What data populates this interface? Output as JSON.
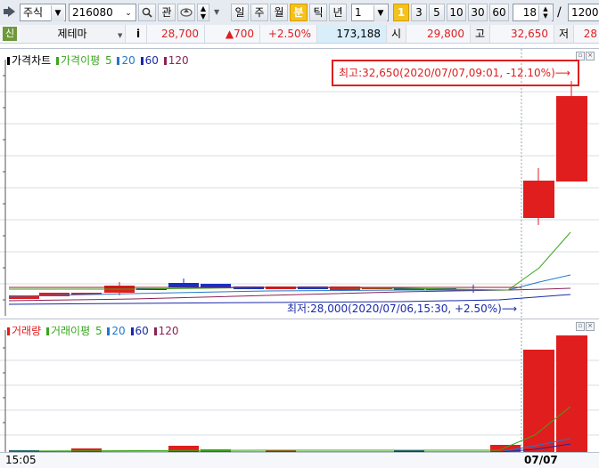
{
  "toolbar": {
    "market_type": "주식",
    "stock_code": "216080",
    "interest_label": "관",
    "periods": [
      "일",
      "주",
      "월",
      "분",
      "틱",
      "년"
    ],
    "selected_period": "분",
    "interval_value": "1",
    "minute_options": [
      "1",
      "3",
      "5",
      "10",
      "30",
      "60"
    ],
    "selected_minute": "1",
    "range_current": "18",
    "range_separator": "/",
    "range_total": "1200"
  },
  "infobar": {
    "new_badge": "신",
    "theme_label": "제테마",
    "info_label": "i",
    "current_price": "28,700",
    "change": "▲700",
    "change_rate": "+2.50%",
    "volume": "173,188",
    "open_label": "시",
    "open_value": "29,800",
    "high_label": "고",
    "high_value": "32,650",
    "low_label": "저",
    "low_value": "28"
  },
  "price_panel": {
    "legend": {
      "price_chart": "가격차트",
      "ma_label": "가격이평",
      "ma_periods": [
        "5",
        "20",
        "60",
        "120"
      ]
    },
    "high_annotation": "최고:32,650(2020/07/07,09:01, -12.10%)⟶",
    "low_annotation": "최저:28,000(2020/07/06,15:30, +2.50%)⟶"
  },
  "volume_panel": {
    "legend": {
      "volume_label": "거래량",
      "ma_label": "거래이평",
      "ma_periods": [
        "5",
        "20",
        "60",
        "120"
      ]
    }
  },
  "axis": {
    "left_time": "15:05",
    "right_date": "07/07"
  },
  "colors": {
    "up": "#e01e1e",
    "down": "#1530c8",
    "ma5": "#3aa51e",
    "ma20": "#2277cc",
    "ma60": "#1a2aa8",
    "ma120": "#8b2255",
    "selected_button": "#f4c21c"
  },
  "chart_data": {
    "type": "candlestick",
    "price": {
      "high": 32650,
      "low": 28000,
      "last_candles": [
        {
          "time": "07/07 09:00",
          "open": 29800,
          "close": 31100,
          "high": 31400,
          "low": 29600,
          "direction": "up"
        },
        {
          "time": "07/07 09:01",
          "open": 31100,
          "close": 32300,
          "high": 32650,
          "low": 31100,
          "direction": "up"
        }
      ]
    },
    "volume": {
      "last_bars": [
        {
          "time": "07/07 09:00",
          "relative": 0.91
        },
        {
          "time": "07/07 09:01",
          "relative": 1.0
        }
      ]
    }
  }
}
